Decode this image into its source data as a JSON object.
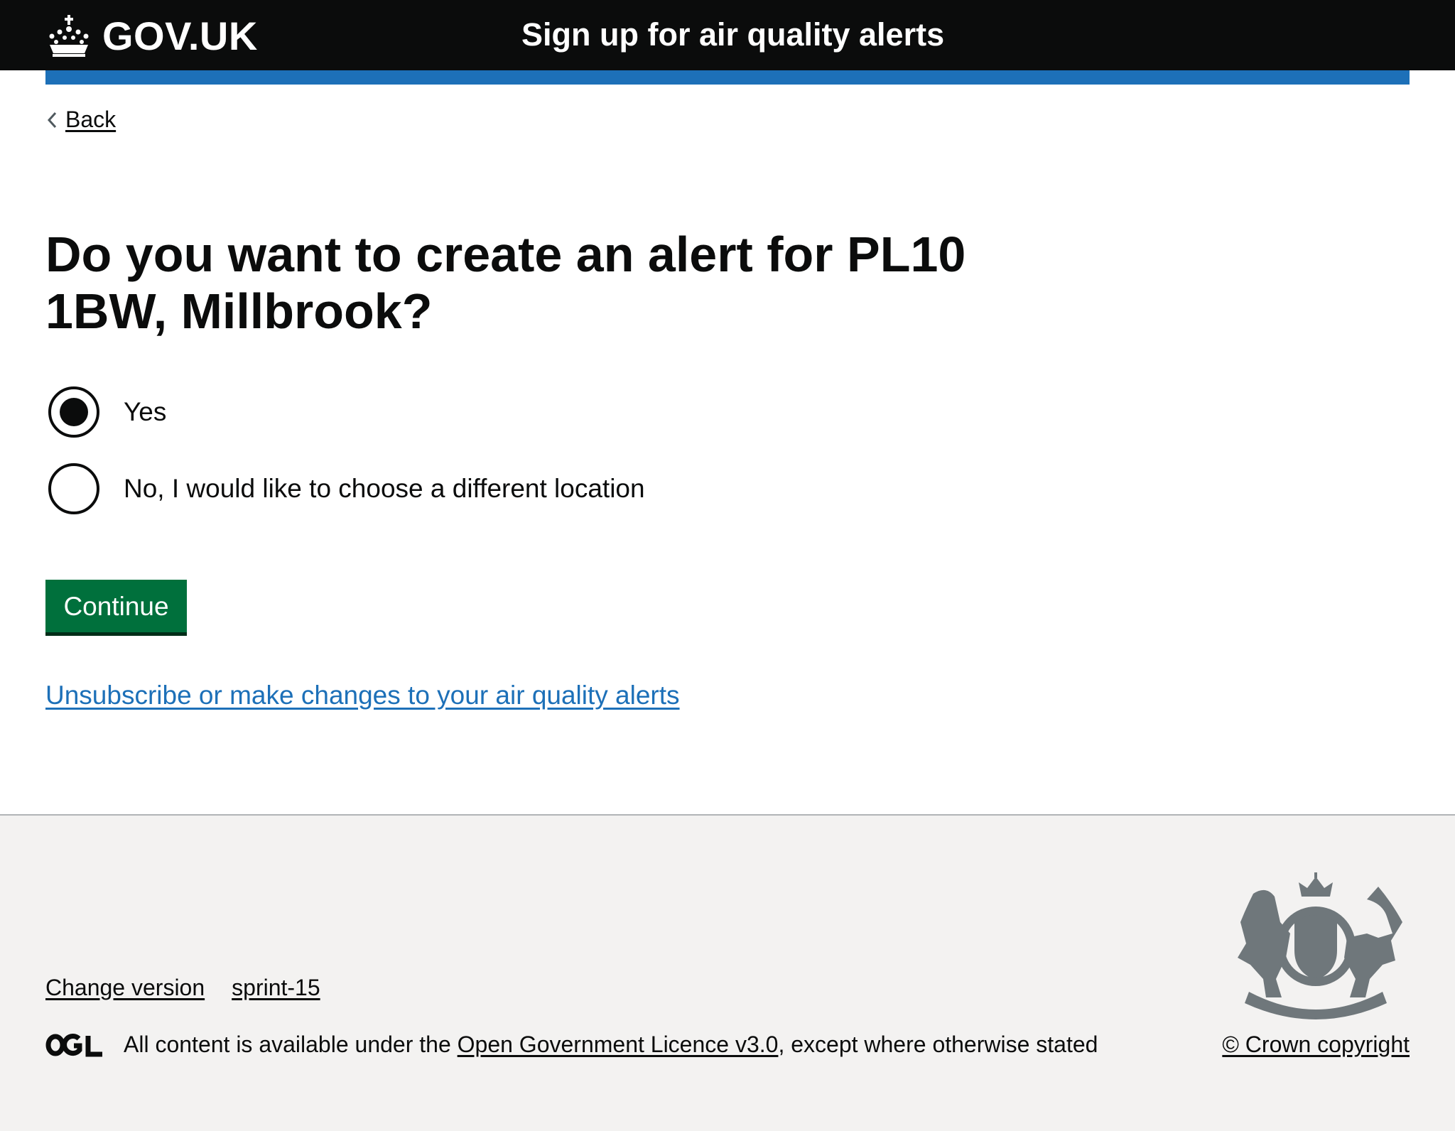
{
  "header": {
    "logo_text": "GOV.UK",
    "service_name": "Sign up for air quality alerts"
  },
  "nav": {
    "back_label": "Back"
  },
  "main": {
    "question": "Do you want to create an alert for PL10 1BW, Millbrook?",
    "options": [
      {
        "label": "Yes",
        "selected": true
      },
      {
        "label": "No, I would like to choose a different location",
        "selected": false
      }
    ],
    "continue_label": "Continue",
    "manage_link": "Unsubscribe or make changes to your air quality alerts"
  },
  "footer": {
    "links": [
      "Change version",
      "sprint-15"
    ],
    "licence_prefix": "All content is available under the ",
    "licence_link": "Open Government Licence v3.0",
    "licence_suffix": ", except where otherwise stated",
    "copyright": "© Crown copyright"
  },
  "colors": {
    "header_bg": "#0b0c0c",
    "accent_blue": "#1d70b8",
    "button_green": "#00703c",
    "footer_bg": "#f3f2f1"
  }
}
